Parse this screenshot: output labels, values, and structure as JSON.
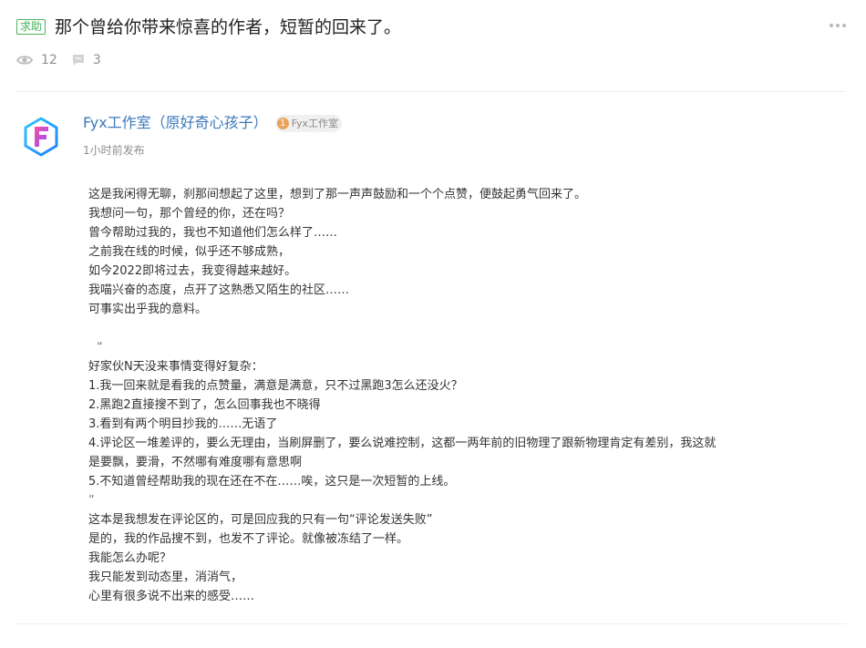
{
  "post": {
    "tag": "求助",
    "title": "那个曾给你带来惊喜的作者，短暂的回来了。",
    "views": "12",
    "comments": "3"
  },
  "author": {
    "name": "Fyx工作室（原好奇心孩子）",
    "badge_number": "1",
    "badge_label": "Fyx工作室",
    "time": "1小时前发布"
  },
  "content": {
    "intro": [
      "这是我闲得无聊，刹那间想起了这里，想到了那一声声鼓励和一个个点赞，便鼓起勇气回来了。",
      "我想问一句，那个曾经的你，还在吗？",
      "曾今帮助过我的，我也不知道他们怎么样了……",
      "之前我在线的时候，似乎还不够成熟，",
      "如今2022即将过去，我变得越来越好。",
      "我喵兴奋的态度，点开了这熟悉又陌生的社区……",
      "可事实出乎我的意料。"
    ],
    "quote_open": "“",
    "quote_lines": [
      "好家伙N天没来事情变得好复杂：",
      "1.我一回来就是看我的点赞量，满意是满意，只不过黑跑3怎么还没火？",
      "2.黑跑2直接搜不到了，怎么回事我也不晓得",
      "3.看到有两个明目抄我的……无语了",
      "4.评论区一堆差评的，要么无理由，当刷屏删了，要么说难控制，这都一两年前的旧物理了跟新物理肯定有差别，我这就",
      "是要飘，要滑，不然哪有难度哪有意思啊",
      "5.不知道曾经帮助我的现在还在不在……唉，这只是一次短暂的上线。"
    ],
    "quote_close": "”",
    "outro": [
      "这本是我想发在评论区的，可是回应我的只有一句“评论发送失败”",
      "是的，我的作品搜不到，也发不了评论。就像被冻结了一样。",
      "我能怎么办呢？",
      "我只能发到动态里，消消气，",
      "心里有很多说不出来的感受……"
    ]
  },
  "icons": {
    "views": "eye-icon",
    "comments": "comment-icon",
    "more": "more-icon",
    "avatar": "fyx-logo-icon"
  },
  "colors": {
    "tag": "#46b45a",
    "author": "#3d79bc",
    "badge_dot": "#e7a25c"
  }
}
